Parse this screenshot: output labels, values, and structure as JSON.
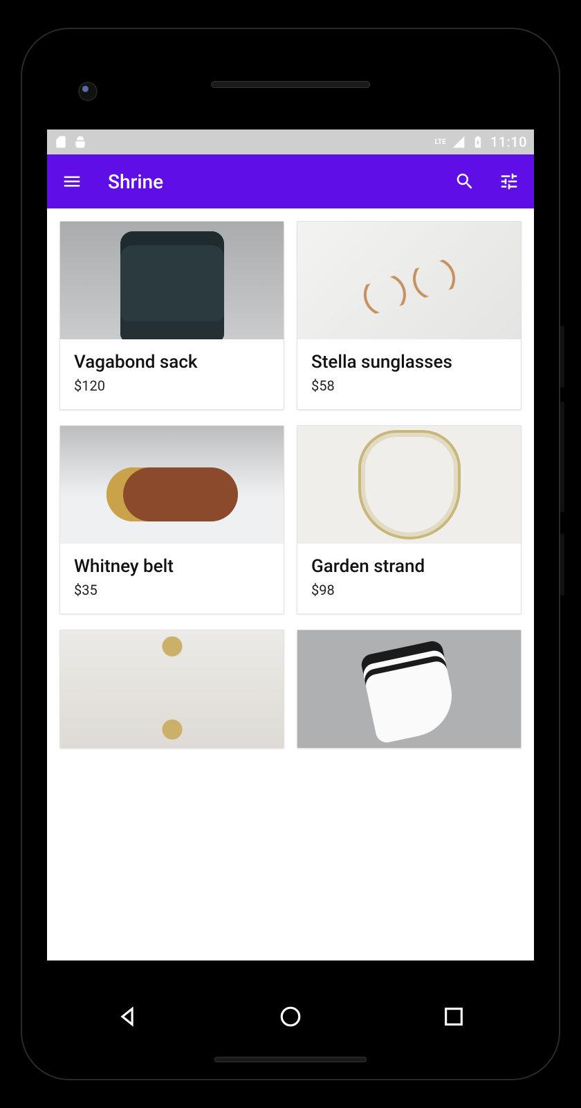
{
  "status": {
    "time": "11:10",
    "signal_label": "LTE"
  },
  "appbar": {
    "title": "Shrine"
  },
  "products": [
    {
      "name": "Vagabond sack",
      "price": "$120",
      "img": "backpack"
    },
    {
      "name": "Stella sunglasses",
      "price": "$58",
      "img": "sunglasses"
    },
    {
      "name": "Whitney belt",
      "price": "$35",
      "img": "belt"
    },
    {
      "name": "Garden strand",
      "price": "$98",
      "img": "strand"
    },
    {
      "name": "",
      "price": "",
      "img": "earrings"
    },
    {
      "name": "",
      "price": "",
      "img": "socks"
    }
  ],
  "colors": {
    "primary": "#5f0ee6"
  }
}
